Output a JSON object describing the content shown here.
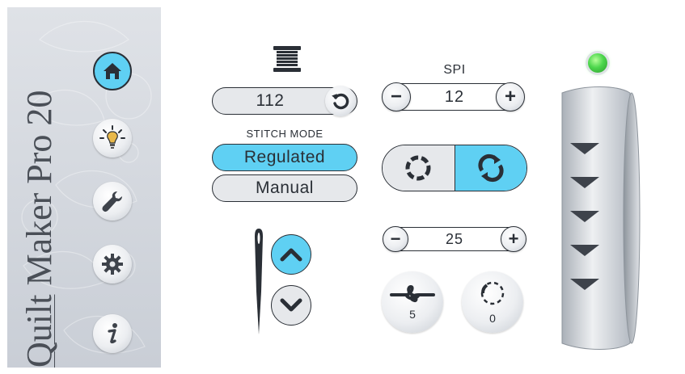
{
  "brand": {
    "word1": "Quilt",
    "word2": " Maker Pro 20"
  },
  "nav": [
    {
      "icon": "home-icon",
      "active": true
    },
    {
      "icon": "lightbulb-icon",
      "active": false
    },
    {
      "icon": "wrench-icon",
      "active": false
    },
    {
      "icon": "gear-icon",
      "active": false
    },
    {
      "icon": "info-icon",
      "active": false
    }
  ],
  "bobbin": {
    "value": "112",
    "icon": "thread-spool-icon",
    "reset_icon": "reset-icon"
  },
  "stitch_mode": {
    "label": "STITCH MODE",
    "options": [
      "Regulated",
      "Manual"
    ],
    "selected": "Regulated"
  },
  "spi": {
    "label": "SPI",
    "value": "12",
    "minus": "−",
    "plus": "+"
  },
  "second_stepper": {
    "value": "25",
    "minus": "−",
    "plus": "+"
  },
  "counters": [
    {
      "icon": "knot-icon",
      "value": "5"
    },
    {
      "icon": "dashed-circle-icon",
      "value": "0"
    }
  ],
  "mode_toggle": {
    "options": [
      "single-cycle",
      "continuous"
    ],
    "selected": "continuous"
  },
  "colors": {
    "accent": "#5fd0f3",
    "ink": "#2a2f36",
    "status_led": "#4cd64c"
  }
}
